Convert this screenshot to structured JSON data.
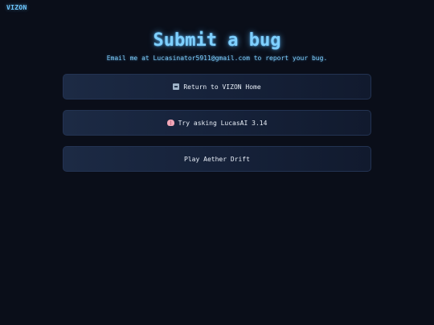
{
  "brand": {
    "name": "VIZON"
  },
  "header": {
    "title": "Submit a bug",
    "subtitle": "Email me at Lucasinator5911@gmail.com to report your bug."
  },
  "actions": [
    {
      "label": "Return to VIZON Home",
      "icon": "home-icon"
    },
    {
      "label": "Try asking LucasAI 3.14",
      "icon": "brain-icon"
    },
    {
      "label": "Play Aether Drift",
      "icon": ""
    }
  ],
  "colors": {
    "background": "#0a0e19",
    "accent": "#7fd0ff",
    "button_border": "#233352"
  }
}
